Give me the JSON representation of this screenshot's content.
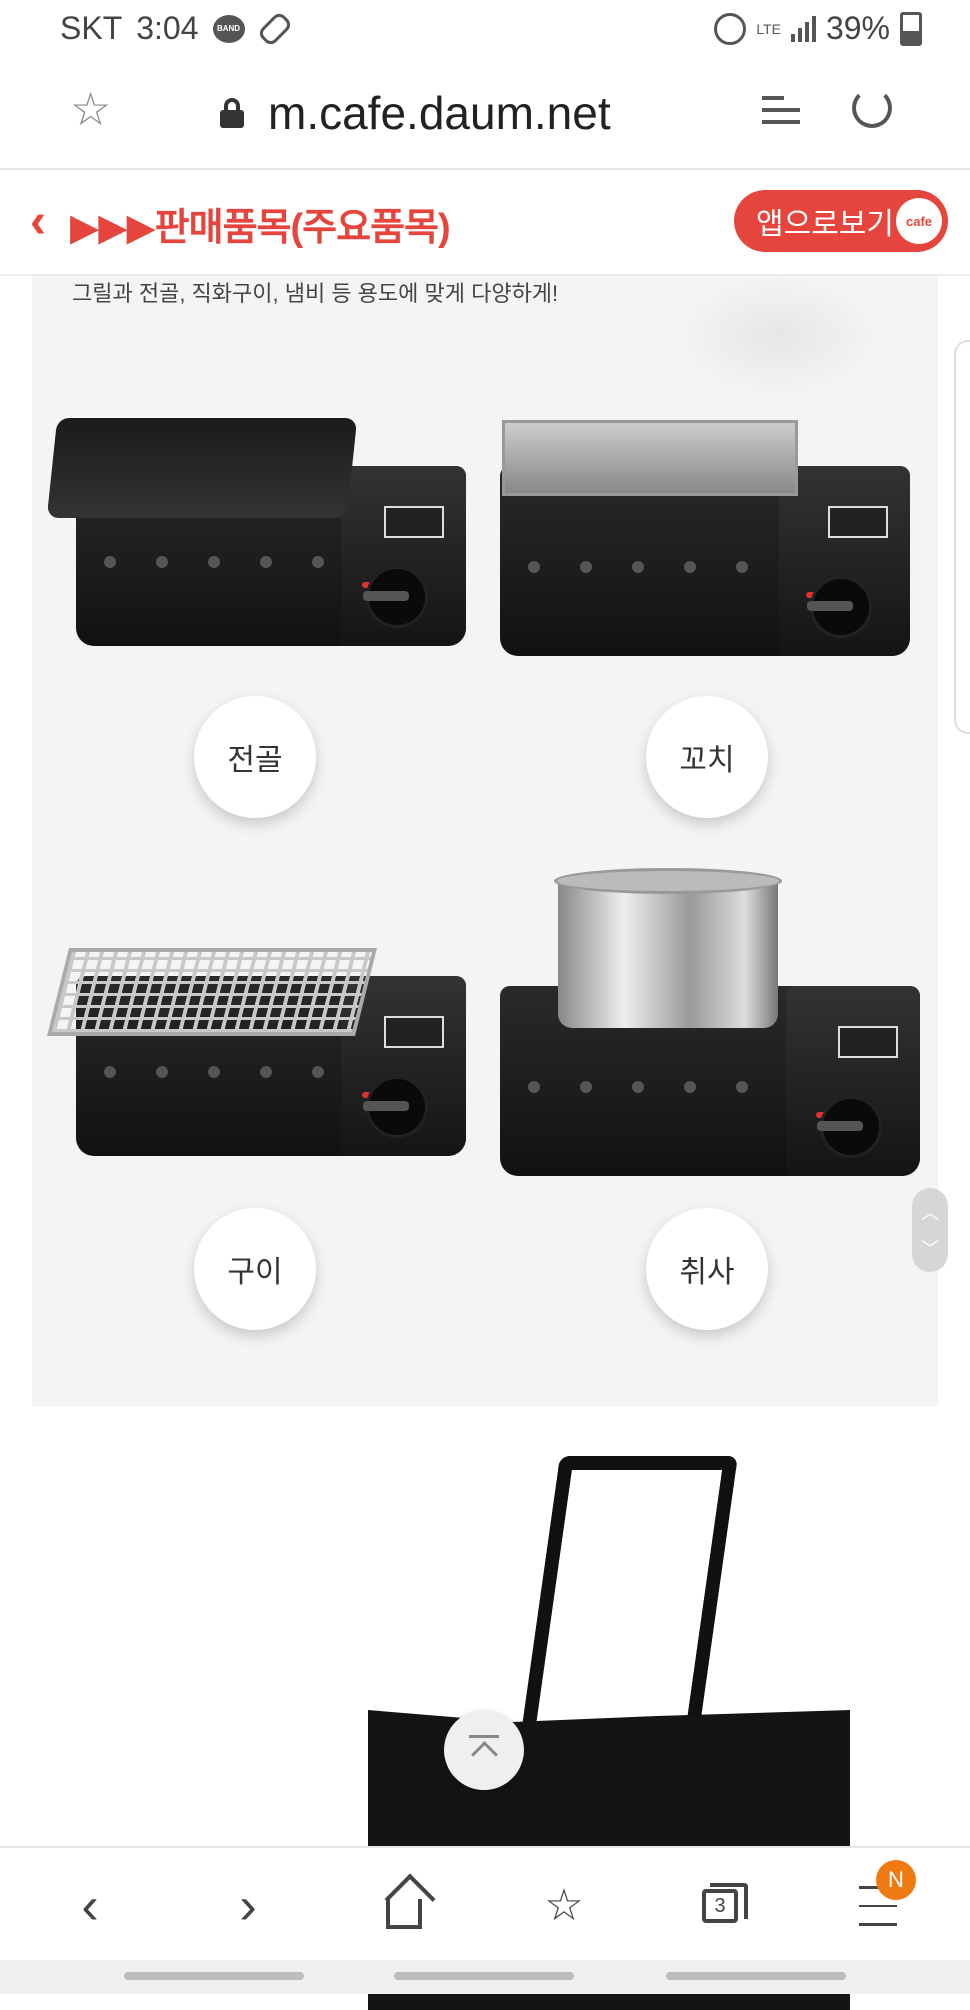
{
  "status_bar": {
    "carrier": "SKT",
    "time": "3:04",
    "band_label": "BAND",
    "network": "LTE",
    "battery": "39%"
  },
  "browser": {
    "url": "m.cafe.daum.net"
  },
  "cafe_header": {
    "title": "▶▶▶판매품목(주요품목)",
    "app_button_label": "앱으로보기",
    "cafe_badge": "cafe"
  },
  "content": {
    "caption": "그릴과 전골, 직화구이, 냄비 등 용도에 맞게 다양하게!",
    "products": [
      {
        "label": "전골"
      },
      {
        "label": "꼬치"
      },
      {
        "label": "구이"
      },
      {
        "label": "취사"
      }
    ]
  },
  "bottom_nav": {
    "tab_count": "3",
    "notification_badge": "N"
  },
  "colors": {
    "accent": "#e5453c",
    "badge": "#f07a12",
    "panel_bg": "#f4f4f4"
  }
}
